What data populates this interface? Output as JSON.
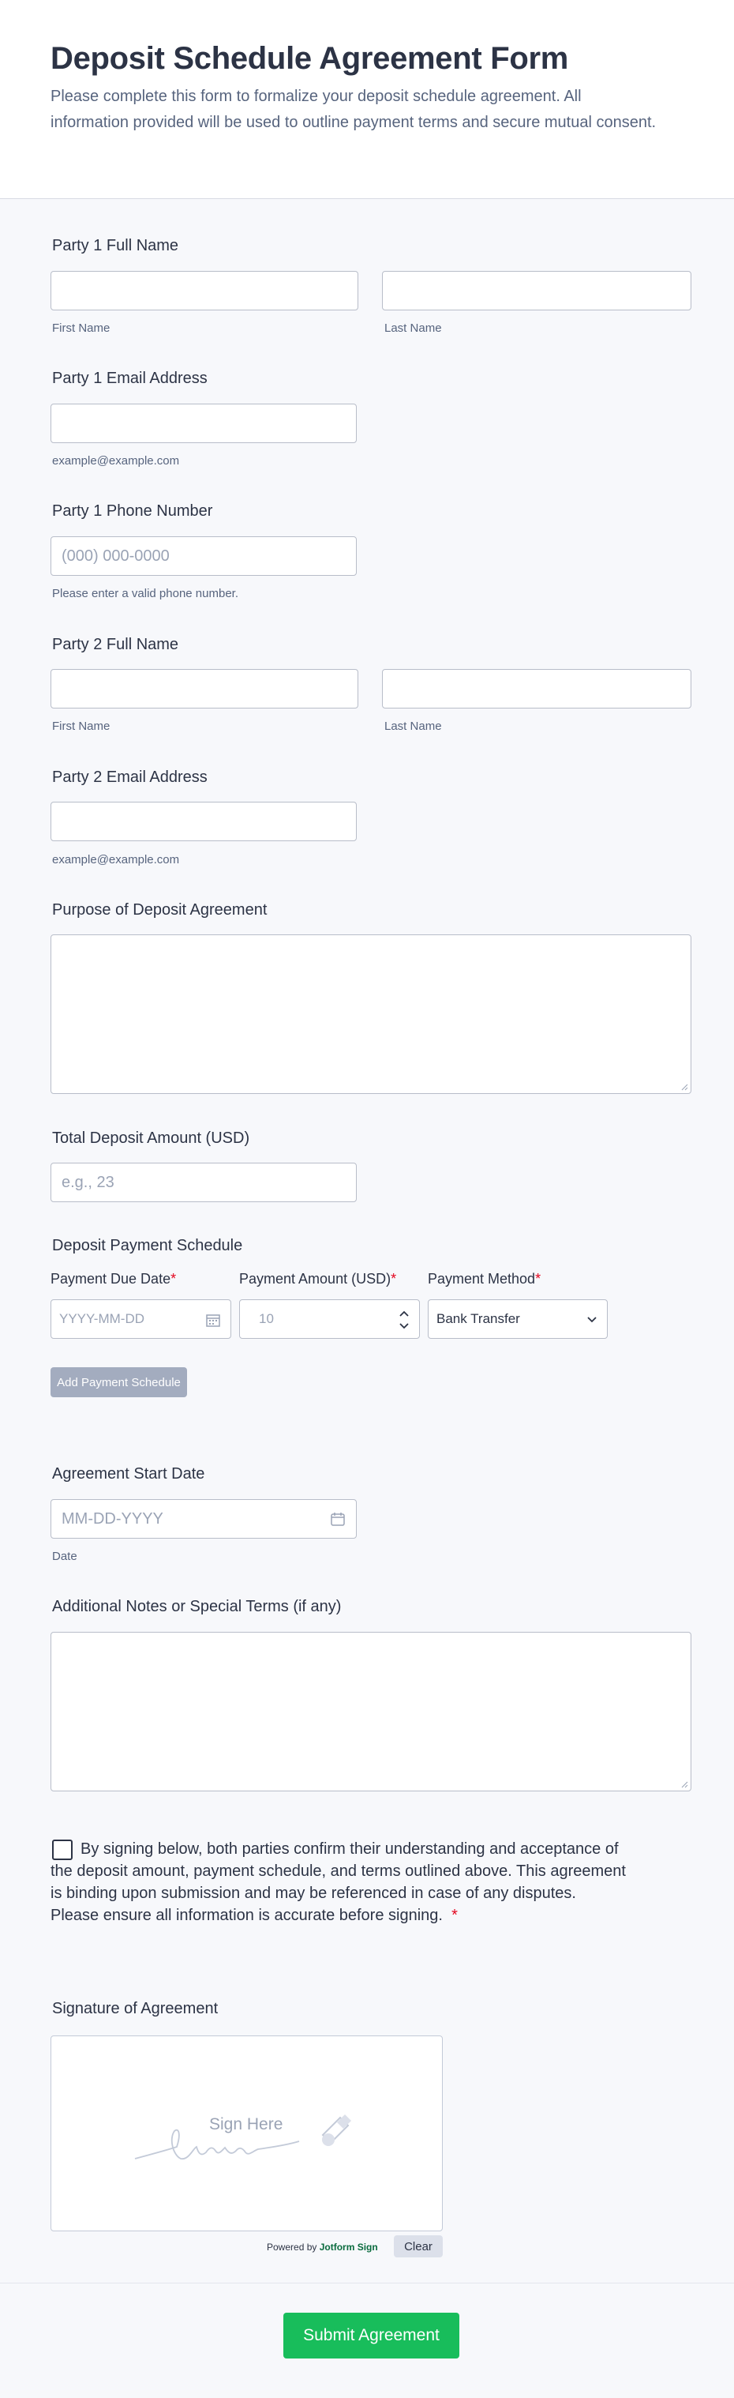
{
  "header": {
    "title": "Deposit Schedule Agreement Form",
    "subtitle": "Please complete this form to formalize your deposit schedule agreement. All information provided will be used to outline payment terms and secure mutual consent."
  },
  "party1_name": {
    "label": "Party 1 Full Name",
    "first_sublabel": "First Name",
    "last_sublabel": "Last Name",
    "first_value": "",
    "last_value": ""
  },
  "party1_email": {
    "label": "Party 1 Email Address",
    "sublabel": "example@example.com",
    "value": ""
  },
  "party1_phone": {
    "label": "Party 1 Phone Number",
    "placeholder": "(000) 000-0000",
    "sublabel": "Please enter a valid phone number."
  },
  "party2_name": {
    "label": "Party 2 Full Name",
    "first_sublabel": "First Name",
    "last_sublabel": "Last Name",
    "first_value": "",
    "last_value": ""
  },
  "party2_email": {
    "label": "Party 2 Email Address",
    "sublabel": "example@example.com",
    "value": ""
  },
  "purpose": {
    "label": "Purpose of Deposit Agreement",
    "value": ""
  },
  "total_deposit": {
    "label": "Total Deposit Amount (USD)",
    "placeholder": "e.g., 23"
  },
  "schedule": {
    "label": "Deposit Payment Schedule",
    "col_due_date": "Payment Due Date",
    "col_amount": "Payment Amount (USD)",
    "col_method": "Payment Method",
    "required_mark": "*",
    "due_date_placeholder": "YYYY-MM-DD",
    "amount_placeholder": "10",
    "method_value": "Bank Transfer",
    "add_button": "Add Payment Schedule"
  },
  "start_date": {
    "label": "Agreement Start Date",
    "placeholder": "MM-DD-YYYY",
    "sublabel": "Date"
  },
  "notes": {
    "label": "Additional Notes or Special Terms (if any)",
    "value": ""
  },
  "consent": {
    "text": "By signing below, both parties confirm their understanding and acceptance of the deposit amount, payment schedule, and terms outlined above. This agreement is binding upon submission and may be referenced in case of any disputes. Please ensure all information is accurate before signing.",
    "required_mark": "*",
    "checked": false
  },
  "signature": {
    "label": "Signature of Agreement",
    "hint": "Sign Here",
    "powered_prefix": "Powered by",
    "powered_brand": "Jotform Sign",
    "clear_button": "Clear"
  },
  "submit": {
    "label": "Submit Agreement"
  },
  "colors": {
    "accent": "#18bd5b",
    "text": "#2c3345",
    "muted": "#57647e",
    "required": "#e3061f",
    "disabled_button": "#a3acbf"
  }
}
